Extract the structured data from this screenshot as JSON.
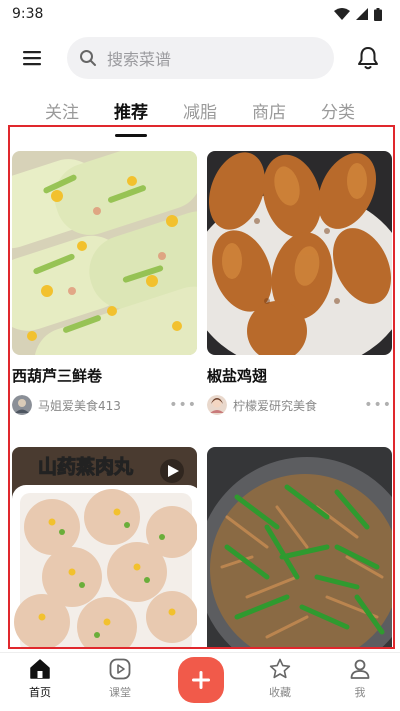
{
  "status_bar": {
    "time": "9:38"
  },
  "search": {
    "placeholder": "搜索菜谱"
  },
  "tabs": [
    {
      "label": "关注"
    },
    {
      "label": "推荐",
      "active": true
    },
    {
      "label": "减脂"
    },
    {
      "label": "商店"
    },
    {
      "label": "分类"
    }
  ],
  "feed": {
    "cards": [
      {
        "title": "西葫芦三鲜卷",
        "author": "马姐爱美食413",
        "image": "zucchini-rolls-photo"
      },
      {
        "title": "椒盐鸡翅",
        "author": "柠檬爱研究美食",
        "image": "fried-chicken-wings-photo"
      },
      {
        "title": "",
        "author": "",
        "image": "yam-meatballs-photo",
        "image_text": "山药蒸肉丸"
      },
      {
        "title": "",
        "author": "",
        "image": "green-pepper-pork-photo"
      }
    ]
  },
  "bottom_nav": [
    {
      "label": "首页",
      "icon": "home-icon",
      "active": true
    },
    {
      "label": "课堂",
      "icon": "play-icon"
    },
    {
      "label": "",
      "icon": "plus-icon"
    },
    {
      "label": "收藏",
      "icon": "star-icon"
    },
    {
      "label": "我",
      "icon": "person-icon"
    }
  ],
  "colors": {
    "accent": "#f15a4a",
    "frame": "#e0282d",
    "text_muted": "#9a9a9a"
  }
}
